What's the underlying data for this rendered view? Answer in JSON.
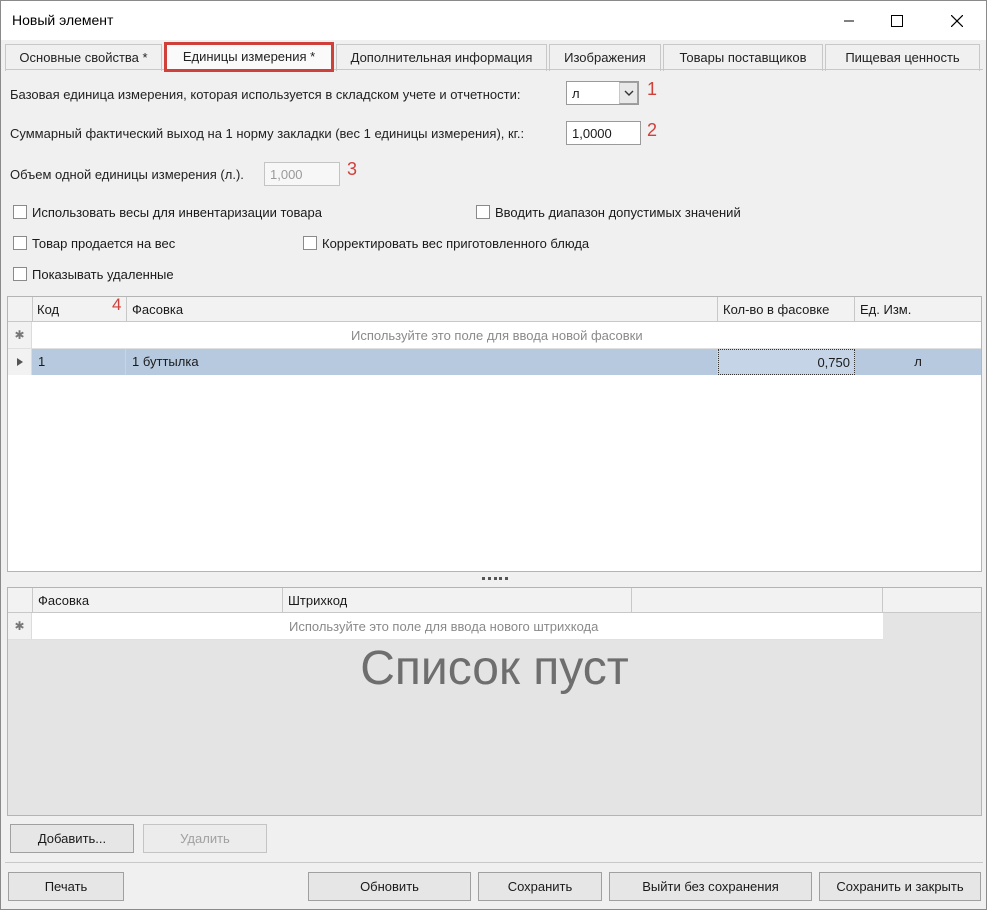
{
  "window": {
    "title": "Новый элемент"
  },
  "tabs": [
    {
      "label": "Основные свойства *"
    },
    {
      "label": "Единицы измерения *"
    },
    {
      "label": "Дополнительная информация"
    },
    {
      "label": "Изображения"
    },
    {
      "label": "Товары поставщиков"
    },
    {
      "label": "Пищевая ценность"
    }
  ],
  "form": {
    "base_unit_label": "Базовая единица измерения, которая используется в складском учете и отчетности:",
    "base_unit_value": "л",
    "total_output_label": "Суммарный фактический выход на 1 норму закладки (вес 1 единицы измерения), кг.:",
    "total_output_value": "1,0000",
    "volume_label": "Объем одной единицы измерения (л.).",
    "volume_value": "1,000"
  },
  "annotations": [
    "1",
    "2",
    "3",
    "4"
  ],
  "checkboxes": [
    {
      "label": "Использовать весы для инвентаризации товара",
      "checked": false
    },
    {
      "label": "Вводить диапазон допустимых значений",
      "checked": false
    },
    {
      "label": "Товар продается на вес",
      "checked": false
    },
    {
      "label": "Корректировать вес приготовленного блюда",
      "checked": false
    },
    {
      "label": "Показывать удаленные",
      "checked": false
    }
  ],
  "packaging_grid": {
    "columns": [
      "Код",
      "Фасовка",
      "Кол-во в фасовке",
      "Ед. Изм."
    ],
    "new_row_hint": "Используйте это поле для ввода новой фасовки",
    "rows": [
      {
        "code": "1",
        "name": "1 буттылка",
        "qty": "0,750",
        "unit": "л"
      }
    ]
  },
  "barcode_grid": {
    "columns": [
      "Фасовка",
      "Штрихкод"
    ],
    "new_row_hint": "Используйте это поле для ввода нового штрихкода",
    "empty_message": "Список пуст"
  },
  "buttons": {
    "add": "Добавить...",
    "delete": "Удалить",
    "print": "Печать",
    "refresh": "Обновить",
    "save": "Сохранить",
    "exit_no_save": "Выйти без сохранения",
    "save_close": "Сохранить и закрыть"
  },
  "colors": {
    "highlight": "#d0403a",
    "selected_row": "#b7c9df"
  }
}
